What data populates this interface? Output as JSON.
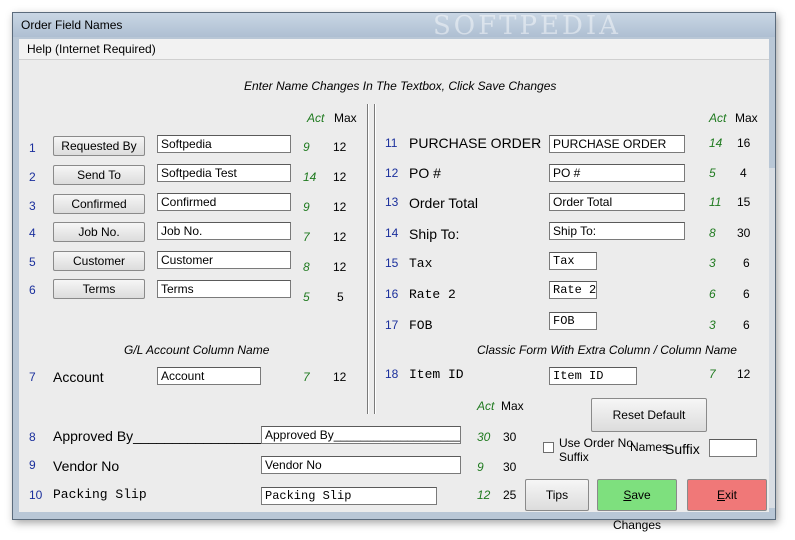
{
  "window": {
    "title": "Order Field Names",
    "watermark": "SOFTPEDIA"
  },
  "menu": {
    "help": "Help (Internet Required)"
  },
  "instructions": "Enter Name Changes In The Textbox, Click Save Changes",
  "col_headers": {
    "act": "Act",
    "max": "Max"
  },
  "left_fields": [
    {
      "num": "1",
      "label": "Requested By",
      "value": "Softpedia",
      "act": "9",
      "max": "12"
    },
    {
      "num": "2",
      "label": "Send To",
      "value": "Softpedia Test",
      "act": "14",
      "max": "12"
    },
    {
      "num": "3",
      "label": "Confirmed",
      "value": "Confirmed",
      "act": "9",
      "max": "12"
    },
    {
      "num": "4",
      "label": "Job No.",
      "value": "Job No.",
      "act": "7",
      "max": "12"
    },
    {
      "num": "5",
      "label": "Customer",
      "value": "Customer",
      "act": "8",
      "max": "12"
    },
    {
      "num": "6",
      "label": "Terms",
      "value": "Terms",
      "act": "5",
      "max": "5"
    }
  ],
  "gl_section": {
    "header": "G/L Account Column Name",
    "num": "7",
    "label": "Account",
    "value": "Account",
    "act": "7",
    "max": "12"
  },
  "right_fields": [
    {
      "num": "11",
      "label": "PURCHASE ORDER",
      "value": "PURCHASE ORDER",
      "act": "14",
      "max": "16"
    },
    {
      "num": "12",
      "label": "PO #",
      "value": "PO #",
      "act": "5",
      "max": "4"
    },
    {
      "num": "13",
      "label": "Order Total",
      "value": "Order Total",
      "act": "11",
      "max": "15"
    },
    {
      "num": "14",
      "label": "Ship To:",
      "value": "Ship To:",
      "act": "8",
      "max": "30"
    },
    {
      "num": "15",
      "label": "Tax",
      "value": "Tax",
      "act": "3",
      "max": "6"
    },
    {
      "num": "16",
      "label": "Rate 2",
      "value": "Rate 2",
      "act": "6",
      "max": "6"
    },
    {
      "num": "17",
      "label": "FOB",
      "value": "FOB",
      "act": "3",
      "max": "6"
    }
  ],
  "classic_section": {
    "header": "Classic Form With Extra Column / Column Name",
    "num": "18",
    "label": "Item ID",
    "value": "Item ID",
    "act": "7",
    "max": "12"
  },
  "bottom_fields": [
    {
      "num": "8",
      "label": "Approved By_______________________",
      "value": "Approved By___________________",
      "act": "30",
      "max": "30"
    },
    {
      "num": "9",
      "label": "Vendor No",
      "value": "Vendor No",
      "act": "9",
      "max": "30"
    },
    {
      "num": "10",
      "label": "Packing Slip",
      "value": "Packing Slip",
      "act": "12",
      "max": "25"
    }
  ],
  "suffix": {
    "checkbox_label_1": "Use Order No.",
    "checkbox_label_2": "Suffix",
    "label": "Suffix",
    "value": ""
  },
  "buttons": {
    "reset": "Reset Default Names",
    "tips": "Tips",
    "save_s": "S",
    "save_rest": "ave Changes",
    "exit_e": "E",
    "exit_rest": "xit"
  },
  "colors": {
    "save_bg": "#7ee07e",
    "exit_bg": "#f07878",
    "number_blue": "#1a2f9c",
    "count_green": "#1f7a1f"
  }
}
